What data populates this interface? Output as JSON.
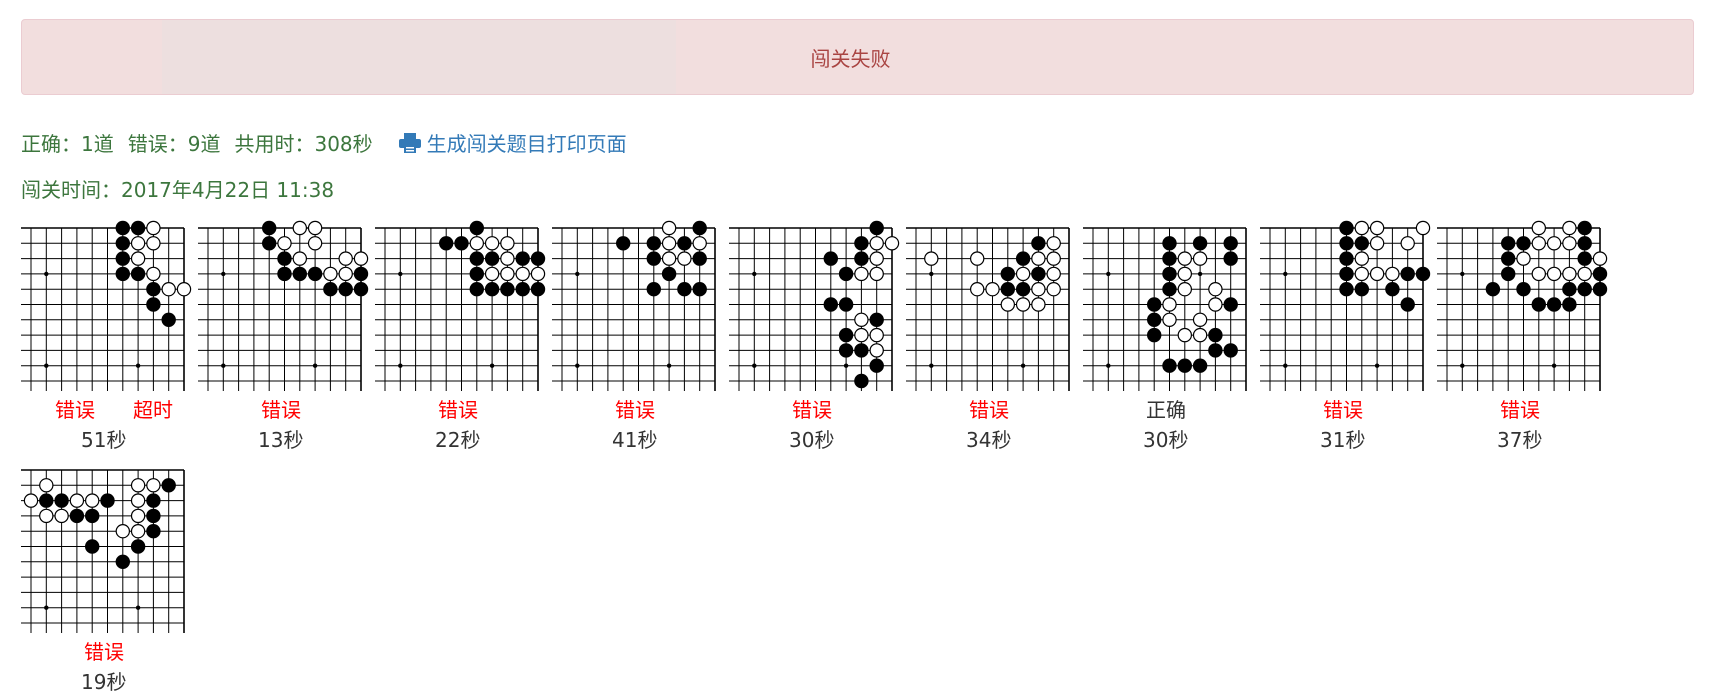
{
  "alert": {
    "text": "闯关失败"
  },
  "summary": {
    "correct": "正确：1道",
    "wrong": "错误：9道",
    "total_time": "共用时：308秒",
    "print_link": "生成闯关题目打印页面"
  },
  "time_line": "闯关时间：2017年4月22日 11:38",
  "colors": {
    "wrong": "#ff0000",
    "correct": "#333333",
    "stats": "#3c763d",
    "link": "#337ab7",
    "alert_text": "#a94442"
  },
  "problems": [
    {
      "status": "错误",
      "extra": "超时",
      "time": "51秒",
      "black": [
        [
          6,
          0
        ],
        [
          7,
          0
        ],
        [
          6,
          1
        ],
        [
          6,
          2
        ],
        [
          6,
          3
        ],
        [
          7,
          3
        ],
        [
          8,
          4
        ],
        [
          8,
          5
        ],
        [
          9,
          6
        ]
      ],
      "white": [
        [
          8,
          0
        ],
        [
          7,
          1
        ],
        [
          8,
          1
        ],
        [
          7,
          2
        ],
        [
          8,
          3
        ],
        [
          9,
          4
        ],
        [
          10,
          4
        ]
      ]
    },
    {
      "status": "错误",
      "time": "13秒",
      "black": [
        [
          4,
          0
        ],
        [
          4,
          1
        ],
        [
          5,
          2
        ],
        [
          5,
          3
        ],
        [
          6,
          3
        ],
        [
          7,
          3
        ],
        [
          10,
          3
        ],
        [
          8,
          4
        ],
        [
          9,
          4
        ],
        [
          10,
          4
        ]
      ],
      "white": [
        [
          6,
          0
        ],
        [
          7,
          0
        ],
        [
          5,
          1
        ],
        [
          7,
          1
        ],
        [
          6,
          2
        ],
        [
          9,
          2
        ],
        [
          10,
          2
        ],
        [
          8,
          3
        ],
        [
          9,
          3
        ]
      ]
    },
    {
      "status": "错误",
      "time": "22秒",
      "black": [
        [
          6,
          0
        ],
        [
          4,
          1
        ],
        [
          5,
          1
        ],
        [
          7,
          2
        ],
        [
          6,
          2
        ],
        [
          9,
          2
        ],
        [
          10,
          2
        ],
        [
          6,
          3
        ],
        [
          6,
          4
        ],
        [
          7,
          4
        ],
        [
          8,
          4
        ],
        [
          9,
          4
        ],
        [
          10,
          4
        ]
      ],
      "white": [
        [
          6,
          1
        ],
        [
          7,
          1
        ],
        [
          8,
          1
        ],
        [
          8,
          2
        ],
        [
          7,
          3
        ],
        [
          8,
          3
        ],
        [
          9,
          3
        ],
        [
          10,
          3
        ]
      ]
    },
    {
      "status": "错误",
      "time": "41秒",
      "black": [
        [
          9,
          0
        ],
        [
          4,
          1
        ],
        [
          6,
          1
        ],
        [
          8,
          1
        ],
        [
          6,
          2
        ],
        [
          9,
          2
        ],
        [
          7,
          3
        ],
        [
          6,
          4
        ],
        [
          8,
          4
        ],
        [
          9,
          4
        ]
      ],
      "white": [
        [
          7,
          0
        ],
        [
          7,
          1
        ],
        [
          9,
          1
        ],
        [
          7,
          2
        ],
        [
          8,
          2
        ]
      ]
    },
    {
      "status": "错误",
      "time": "30秒",
      "black": [
        [
          9,
          0
        ],
        [
          8,
          1
        ],
        [
          6,
          2
        ],
        [
          8,
          2
        ],
        [
          7,
          3
        ],
        [
          6,
          5
        ],
        [
          7,
          5
        ],
        [
          9,
          6
        ],
        [
          7,
          7
        ],
        [
          7,
          8
        ],
        [
          8,
          8
        ],
        [
          9,
          9
        ],
        [
          8,
          10
        ]
      ],
      "white": [
        [
          9,
          1
        ],
        [
          10,
          1
        ],
        [
          9,
          2
        ],
        [
          8,
          3
        ],
        [
          9,
          3
        ],
        [
          8,
          6
        ],
        [
          8,
          7
        ],
        [
          9,
          7
        ],
        [
          9,
          8
        ]
      ]
    },
    {
      "status": "错误",
      "time": "34秒",
      "black": [
        [
          8,
          1
        ],
        [
          7,
          2
        ],
        [
          6,
          3
        ],
        [
          8,
          3
        ],
        [
          6,
          4
        ],
        [
          7,
          4
        ]
      ],
      "white": [
        [
          9,
          1
        ],
        [
          1,
          2
        ],
        [
          4,
          2
        ],
        [
          8,
          2
        ],
        [
          9,
          2
        ],
        [
          7,
          3
        ],
        [
          9,
          3
        ],
        [
          4,
          4
        ],
        [
          5,
          4
        ],
        [
          8,
          4
        ],
        [
          9,
          4
        ],
        [
          6,
          5
        ],
        [
          7,
          5
        ],
        [
          8,
          5
        ]
      ]
    },
    {
      "status": "正确",
      "time": "30秒",
      "black": [
        [
          5,
          1
        ],
        [
          7,
          1
        ],
        [
          9,
          1
        ],
        [
          5,
          2
        ],
        [
          9,
          2
        ],
        [
          5,
          3
        ],
        [
          5,
          4
        ],
        [
          4,
          5
        ],
        [
          4,
          6
        ],
        [
          4,
          7
        ],
        [
          8,
          7
        ],
        [
          8,
          8
        ],
        [
          9,
          8
        ],
        [
          9,
          5
        ],
        [
          6,
          9
        ],
        [
          7,
          9
        ],
        [
          5,
          9
        ]
      ],
      "white": [
        [
          6,
          2
        ],
        [
          7,
          2
        ],
        [
          6,
          3
        ],
        [
          6,
          4
        ],
        [
          8,
          4
        ],
        [
          5,
          5
        ],
        [
          8,
          5
        ],
        [
          5,
          6
        ],
        [
          7,
          6
        ],
        [
          7,
          7
        ],
        [
          6,
          7
        ]
      ]
    },
    {
      "status": "错误",
      "time": "31秒",
      "black": [
        [
          5,
          0
        ],
        [
          5,
          1
        ],
        [
          6,
          1
        ],
        [
          5,
          2
        ],
        [
          5,
          3
        ],
        [
          9,
          3
        ],
        [
          10,
          3
        ],
        [
          5,
          4
        ],
        [
          6,
          4
        ],
        [
          8,
          4
        ],
        [
          9,
          5
        ]
      ],
      "white": [
        [
          6,
          0
        ],
        [
          7,
          0
        ],
        [
          10,
          0
        ],
        [
          7,
          1
        ],
        [
          9,
          1
        ],
        [
          6,
          2
        ],
        [
          6,
          3
        ],
        [
          7,
          3
        ],
        [
          8,
          3
        ]
      ]
    },
    {
      "status": "错误",
      "time": "37秒",
      "black": [
        [
          9,
          0
        ],
        [
          4,
          1
        ],
        [
          5,
          1
        ],
        [
          9,
          1
        ],
        [
          4,
          2
        ],
        [
          9,
          2
        ],
        [
          4,
          3
        ],
        [
          10,
          3
        ],
        [
          3,
          4
        ],
        [
          5,
          4
        ],
        [
          8,
          4
        ],
        [
          9,
          4
        ],
        [
          10,
          4
        ],
        [
          6,
          5
        ],
        [
          7,
          5
        ],
        [
          8,
          5
        ]
      ],
      "white": [
        [
          6,
          0
        ],
        [
          8,
          0
        ],
        [
          6,
          1
        ],
        [
          7,
          1
        ],
        [
          8,
          1
        ],
        [
          5,
          2
        ],
        [
          10,
          2
        ],
        [
          6,
          3
        ],
        [
          7,
          3
        ],
        [
          8,
          3
        ],
        [
          9,
          3
        ]
      ]
    },
    {
      "status": "错误",
      "time": "19秒",
      "black": [
        [
          9,
          1
        ],
        [
          1,
          2
        ],
        [
          2,
          2
        ],
        [
          5,
          2
        ],
        [
          8,
          2
        ],
        [
          3,
          3
        ],
        [
          4,
          3
        ],
        [
          8,
          3
        ],
        [
          8,
          4
        ],
        [
          4,
          5
        ],
        [
          7,
          5
        ],
        [
          6,
          6
        ]
      ],
      "white": [
        [
          1,
          1
        ],
        [
          7,
          1
        ],
        [
          8,
          1
        ],
        [
          0,
          2
        ],
        [
          3,
          2
        ],
        [
          4,
          2
        ],
        [
          7,
          2
        ],
        [
          1,
          3
        ],
        [
          2,
          3
        ],
        [
          7,
          3
        ],
        [
          6,
          4
        ],
        [
          7,
          4
        ]
      ]
    }
  ]
}
